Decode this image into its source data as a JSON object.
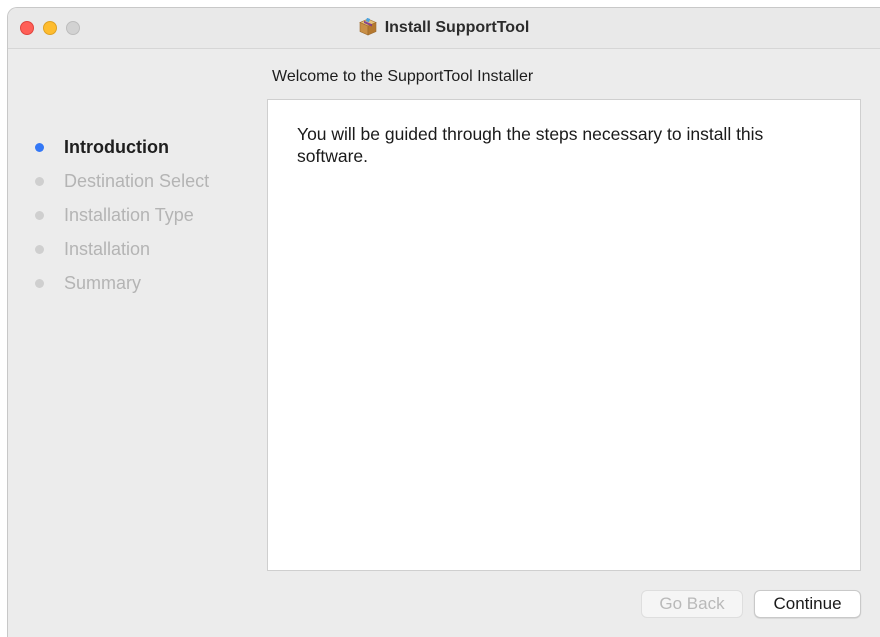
{
  "window": {
    "title": "Install SupportTool",
    "title_icon": "package-icon"
  },
  "heading": "Welcome to the SupportTool Installer",
  "steps": [
    {
      "label": "Introduction",
      "active": true
    },
    {
      "label": "Destination Select",
      "active": false
    },
    {
      "label": "Installation Type",
      "active": false
    },
    {
      "label": "Installation",
      "active": false
    },
    {
      "label": "Summary",
      "active": false
    }
  ],
  "content": {
    "message": "You will be guided through the steps necessary to install this software."
  },
  "buttons": {
    "back_label": "Go Back",
    "back_enabled": false,
    "continue_label": "Continue"
  },
  "colors": {
    "active_step_dot": "#3478f6",
    "close": "#ff5f57",
    "minimize": "#febc2e",
    "zoom_disabled": "#d2d2d2"
  }
}
